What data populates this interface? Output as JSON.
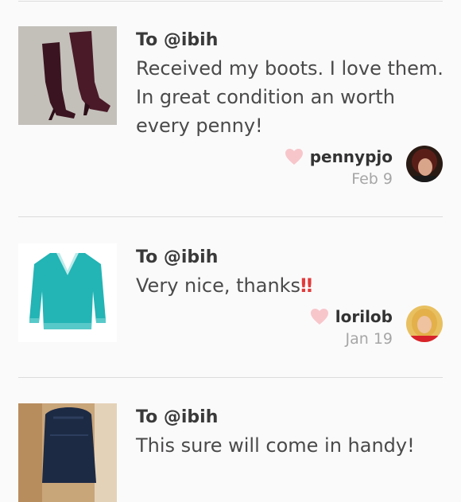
{
  "reviews": [
    {
      "to": "To @ibih",
      "message": "Received my boots. I love them. In great condition an worth every penny!",
      "user": "pennypjo",
      "date": "Feb 9",
      "thumb_icon": "boots-photo",
      "avatar_icon": "avatar-pennypjo"
    },
    {
      "to": "To @ibih",
      "message": "Very nice, thanks",
      "emoji": "‼",
      "user": "lorilob",
      "date": "Jan 19",
      "thumb_icon": "sweater-photo",
      "avatar_icon": "avatar-lorilob"
    },
    {
      "to": "To @ibih",
      "message": "This sure will come in handy!",
      "thumb_icon": "bag-photo"
    }
  ],
  "colors": {
    "heart": "#f7c6cb",
    "divider": "#dcdcdc",
    "emoji": "#e23a3a",
    "date": "#a6a6a6"
  }
}
